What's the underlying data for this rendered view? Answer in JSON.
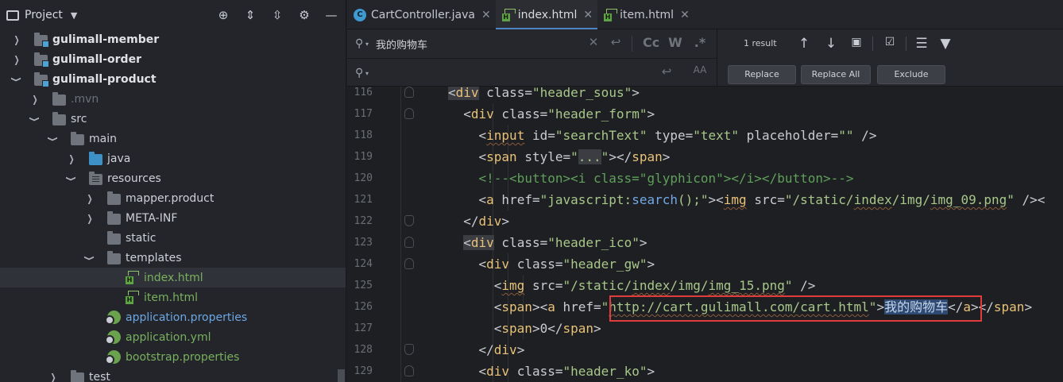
{
  "project_panel": {
    "title": "Project",
    "tree": [
      {
        "label": "gulimall-member",
        "depth": 0,
        "arrow": "›",
        "icon": "module-folder-icon",
        "style": "bold"
      },
      {
        "label": "gulimall-order",
        "depth": 0,
        "arrow": "›",
        "icon": "module-folder-icon",
        "style": "bold"
      },
      {
        "label": "gulimall-product",
        "depth": 0,
        "arrow": "⌄",
        "icon": "module-folder-icon",
        "style": "bold"
      },
      {
        "label": ".mvn",
        "depth": 1,
        "arrow": "›",
        "icon": "folder-icon",
        "style": "dim"
      },
      {
        "label": "src",
        "depth": 1,
        "arrow": "⌄",
        "icon": "folder-icon",
        "style": ""
      },
      {
        "label": "main",
        "depth": 2,
        "arrow": "⌄",
        "icon": "folder-icon",
        "style": ""
      },
      {
        "label": "java",
        "depth": 3,
        "arrow": "›",
        "icon": "source-folder-icon",
        "style": ""
      },
      {
        "label": "resources",
        "depth": 3,
        "arrow": "⌄",
        "icon": "resources-folder-icon",
        "style": ""
      },
      {
        "label": "mapper.product",
        "depth": 4,
        "arrow": "›",
        "icon": "folder-icon",
        "style": ""
      },
      {
        "label": "META-INF",
        "depth": 4,
        "arrow": "›",
        "icon": "folder-icon",
        "style": ""
      },
      {
        "label": "static",
        "depth": 4,
        "arrow": "",
        "icon": "folder-icon",
        "style": ""
      },
      {
        "label": "templates",
        "depth": 4,
        "arrow": "⌄",
        "icon": "folder-icon",
        "style": ""
      },
      {
        "label": "index.html",
        "depth": 5,
        "arrow": "",
        "icon": "html-file-icon",
        "style": "green",
        "selected": true
      },
      {
        "label": "item.html",
        "depth": 5,
        "arrow": "",
        "icon": "html-file-icon",
        "style": "green"
      },
      {
        "label": "application.properties",
        "depth": 4,
        "arrow": "",
        "icon": "spring-config-icon",
        "style": "blue"
      },
      {
        "label": "application.yml",
        "depth": 4,
        "arrow": "",
        "icon": "spring-config-icon",
        "style": "green"
      },
      {
        "label": "bootstrap.properties",
        "depth": 4,
        "arrow": "",
        "icon": "spring-config-icon",
        "style": "green"
      },
      {
        "label": "test",
        "depth": 2,
        "arrow": "›",
        "icon": "folder-icon",
        "style": ""
      }
    ]
  },
  "tabs": [
    {
      "label": "CartController.java",
      "icon": "java-class-icon",
      "active": false
    },
    {
      "label": "index.html",
      "icon": "html-file-icon",
      "active": true
    },
    {
      "label": "item.html",
      "icon": "html-file-icon",
      "active": false
    }
  ],
  "find": {
    "search_value": "我的购物车",
    "replace_value": "",
    "result_count": "1 result",
    "match_case_label": "Cc",
    "words_label": "W",
    "regex_label": ".*",
    "preserve_case_label": "AA",
    "replace_label": "Replace",
    "replace_all_label": "Replace All",
    "exclude_label": "Exclude"
  },
  "code_lines": [
    {
      "n": "116",
      "indent": 3,
      "fold": "up",
      "tokens": [
        [
          "br tagbg",
          "<"
        ],
        [
          "tag tagbg",
          "div"
        ],
        [
          "attr",
          " class="
        ],
        [
          "val",
          "\"header_sous\""
        ],
        [
          "br",
          ">"
        ]
      ]
    },
    {
      "n": "117",
      "indent": 4,
      "fold": "up",
      "tokens": [
        [
          "br",
          "<"
        ],
        [
          "tag",
          "div"
        ],
        [
          "attr",
          " class="
        ],
        [
          "val",
          "\"header_form\""
        ],
        [
          "br",
          ">"
        ]
      ]
    },
    {
      "n": "118",
      "indent": 5,
      "fold": "",
      "tokens": [
        [
          "br",
          "<"
        ],
        [
          "tag squig",
          "input"
        ],
        [
          "attr",
          " id="
        ],
        [
          "val",
          "\"searchText\""
        ],
        [
          "attr",
          " type="
        ],
        [
          "val",
          "\"text\""
        ],
        [
          "attr",
          " placeholder="
        ],
        [
          "val",
          "\"\""
        ],
        [
          "br",
          " />"
        ]
      ]
    },
    {
      "n": "119",
      "indent": 5,
      "fold": "",
      "tokens": [
        [
          "br",
          "<"
        ],
        [
          "tag",
          "span"
        ],
        [
          "attr",
          " style="
        ],
        [
          "val",
          "\""
        ],
        [
          "val tagbg",
          "..."
        ],
        [
          "val",
          "\""
        ],
        [
          "br",
          "></"
        ],
        [
          "tag",
          "span"
        ],
        [
          "br",
          ">"
        ]
      ]
    },
    {
      "n": "120",
      "indent": 5,
      "fold": "",
      "tokens": [
        [
          "cmt",
          "<!--<button><i class=\"glyphicon\"></i></button>-->"
        ]
      ]
    },
    {
      "n": "121",
      "indent": 5,
      "fold": "",
      "tokens": [
        [
          "br",
          "<"
        ],
        [
          "tag",
          "a"
        ],
        [
          "attr",
          " href="
        ],
        [
          "val",
          "\"javascript:"
        ],
        [
          "fn",
          "search"
        ],
        [
          "val",
          "();\""
        ],
        [
          "br",
          "><"
        ],
        [
          "tag squig",
          "img"
        ],
        [
          "attr",
          " src="
        ],
        [
          "val",
          "\"/static/"
        ],
        [
          "val squig",
          "index"
        ],
        [
          "val",
          "/img/"
        ],
        [
          "val squig",
          "img_09.png"
        ],
        [
          "val",
          "\""
        ],
        [
          "br",
          " /><"
        ]
      ]
    },
    {
      "n": "122",
      "indent": 4,
      "fold": "down",
      "tokens": [
        [
          "br",
          "</"
        ],
        [
          "tag",
          "div"
        ],
        [
          "br",
          ">"
        ]
      ]
    },
    {
      "n": "123",
      "indent": 4,
      "fold": "up",
      "tokens": [
        [
          "br tagbg",
          "<"
        ],
        [
          "tag tagbg",
          "div"
        ],
        [
          "attr",
          " class="
        ],
        [
          "val",
          "\"header_ico\""
        ],
        [
          "br",
          ">"
        ]
      ]
    },
    {
      "n": "124",
      "indent": 5,
      "fold": "up",
      "tokens": [
        [
          "br",
          "<"
        ],
        [
          "tag",
          "div"
        ],
        [
          "attr",
          " class="
        ],
        [
          "val",
          "\"header_gw\""
        ],
        [
          "br",
          ">"
        ]
      ]
    },
    {
      "n": "125",
      "indent": 6,
      "fold": "",
      "tokens": [
        [
          "br",
          "<"
        ],
        [
          "tag squig",
          "img"
        ],
        [
          "attr",
          " src="
        ],
        [
          "val",
          "\"/static/"
        ],
        [
          "val squig",
          "index"
        ],
        [
          "val",
          "/img/"
        ],
        [
          "val squig",
          "img_15.png"
        ],
        [
          "val",
          "\""
        ],
        [
          "br",
          " />"
        ]
      ]
    },
    {
      "n": "126",
      "indent": 6,
      "fold": "",
      "tokens": [
        [
          "br",
          "<"
        ],
        [
          "tag",
          "span"
        ],
        [
          "br",
          "><"
        ],
        [
          "tag",
          "a"
        ],
        [
          "attr",
          " href="
        ],
        [
          "val",
          "\""
        ],
        [
          "val squig",
          "http://cart.gulimall.com/cart.html"
        ],
        [
          "val",
          "\""
        ],
        [
          "br",
          ">"
        ],
        [
          "sel",
          "我的购物车"
        ],
        [
          "br",
          "</"
        ],
        [
          "tag",
          "a"
        ],
        [
          "br",
          "></"
        ],
        [
          "tag",
          "span"
        ],
        [
          "br",
          ">"
        ]
      ]
    },
    {
      "n": "127",
      "indent": 6,
      "fold": "",
      "tokens": [
        [
          "br",
          "<"
        ],
        [
          "tag",
          "span"
        ],
        [
          "br",
          ">0</"
        ],
        [
          "tag",
          "span"
        ],
        [
          "br",
          ">"
        ]
      ]
    },
    {
      "n": "128",
      "indent": 5,
      "fold": "down",
      "tokens": [
        [
          "br",
          "</"
        ],
        [
          "tag",
          "div"
        ],
        [
          "br",
          ">"
        ]
      ]
    },
    {
      "n": "129",
      "indent": 5,
      "fold": "up",
      "tokens": [
        [
          "br",
          "<"
        ],
        [
          "tag",
          "div"
        ],
        [
          "attr",
          " class="
        ],
        [
          "val",
          "\"header_ko\""
        ],
        [
          "br",
          ">"
        ]
      ]
    }
  ]
}
